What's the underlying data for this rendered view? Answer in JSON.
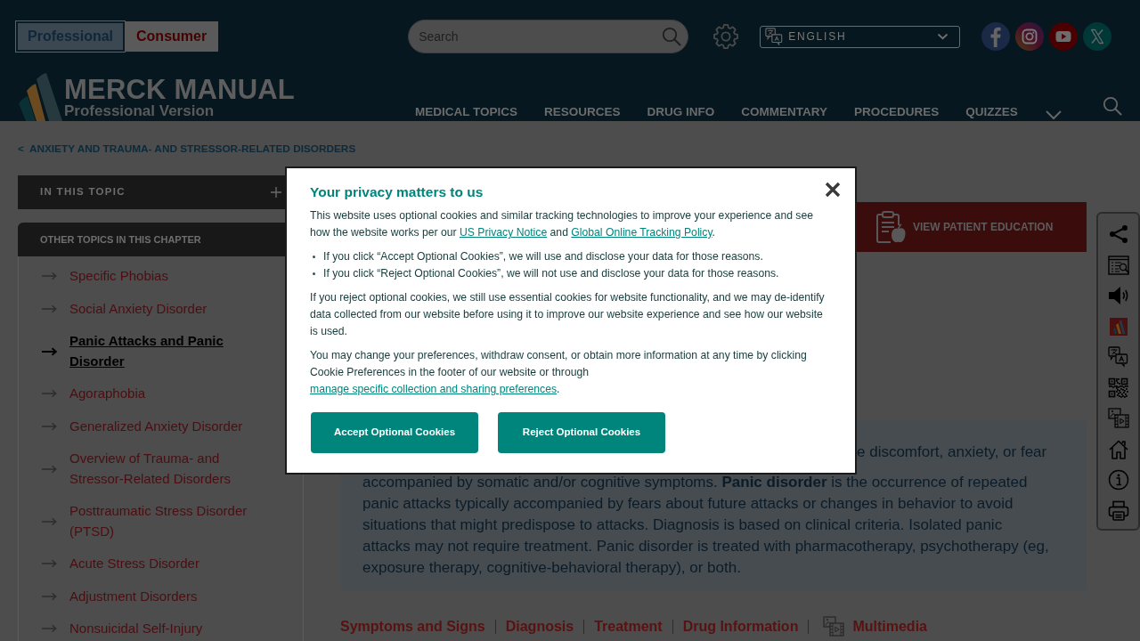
{
  "header": {
    "audience_toggle": [
      {
        "label": "Professional",
        "selected": true
      },
      {
        "label": "Consumer",
        "selected": false
      }
    ],
    "search": {
      "placeholder": "Search"
    },
    "language_select": {
      "value": "ENGLISH"
    },
    "logo": {
      "title": "MERCK MANUAL",
      "subtitle": "Professional Version"
    },
    "nav": [
      "MEDICAL TOPICS",
      "RESOURCES",
      "DRUG INFO",
      "COMMENTARY",
      "PROCEDURES",
      "QUIZZES"
    ]
  },
  "breadcrumb": {
    "marker": "<",
    "label": "ANXIETY AND TRAUMA- AND STRESSOR-RELATED DISORDERS"
  },
  "sidebar": {
    "in_this_topic": {
      "title": "IN THIS TOPIC",
      "expanded": false
    },
    "other_topics": {
      "title": "OTHER TOPICS IN THIS CHAPTER",
      "items": [
        {
          "label": "Specific Phobias",
          "selected": false
        },
        {
          "label": "Social Anxiety Disorder",
          "selected": false
        },
        {
          "label": "Panic Attacks and Panic Disorder",
          "selected": true
        },
        {
          "label": "Agoraphobia",
          "selected": false
        },
        {
          "label": "Generalized Anxiety Disorder",
          "selected": false
        },
        {
          "label": "Overview of Trauma- and Stressor-Related Disorders",
          "selected": false
        },
        {
          "label": "Posttraumatic Stress Disorder (PTSD)",
          "selected": false
        },
        {
          "label": "Acute Stress Disorder",
          "selected": false
        },
        {
          "label": "Adjustment Disorders",
          "selected": false
        },
        {
          "label": "Nonsuicidal Self-Injury",
          "selected": false
        }
      ]
    }
  },
  "patient_education_button": {
    "label": "VIEW PATIENT EDUCATION"
  },
  "summary": {
    "fragment": "e discomfort, anxiety, or fear",
    "text": "accompanied by somatic and/or cognitive symptoms. **Panic disorder** is the occurrence of repeated panic attacks typically accompanied by fears about future attacks or changes in behavior to avoid situations that might predispose to attacks. Diagnosis is based on clinical criteria. Isolated panic attacks may not require treatment. Panic disorder is treated with pharmacotherapy, psychotherapy (eg, exposure therapy, cognitive-behavioral therapy), or both."
  },
  "section_links": [
    {
      "label": "Symptoms and Signs",
      "kind": "text"
    },
    {
      "label": "Diagnosis",
      "kind": "text"
    },
    {
      "label": "Treatment",
      "kind": "text"
    },
    {
      "label": "Drug Information",
      "kind": "text"
    },
    {
      "label": "Multimedia",
      "kind": "media"
    }
  ],
  "cookie_dialog": {
    "title": "Your privacy matters to us",
    "blocks": [
      {
        "kind": "paragraph",
        "segments": [
          {
            "kind": "text",
            "text": "This website uses optional cookies and similar tracking technologies to improve your experience and see how the website works per our "
          },
          {
            "kind": "link",
            "text": "US Privacy Notice"
          },
          {
            "kind": "text",
            "text": " and "
          },
          {
            "kind": "link",
            "text": "Global Online Tracking Policy"
          },
          {
            "kind": "text",
            "text": "."
          }
        ]
      },
      {
        "kind": "bullets",
        "items": [
          "If you click “Accept Optional Cookies”, we will use and disclose your data for those reasons.",
          "If you click “Reject Optional Cookies”, we will not use and disclose your data for those reasons."
        ]
      },
      {
        "kind": "paragraph",
        "segments": [
          {
            "kind": "text",
            "text": "If you reject optional cookies, we still use essential cookies for website functionality, and we may de-identify data collected from our website before using it to improve our website experience and see how our website is used."
          }
        ]
      },
      {
        "kind": "paragraph",
        "segments": [
          {
            "kind": "text",
            "text": "You may change your preferences, withdraw consent, or obtain more information at any time by clicking Cookie Preferences in the footer of our website or through "
          },
          {
            "kind": "link",
            "text": "manage specific collection and sharing preferences"
          },
          {
            "kind": "text",
            "text": "."
          }
        ]
      }
    ],
    "buttons": [
      "Accept Optional Cookies",
      "Reject Optional Cookies"
    ]
  }
}
